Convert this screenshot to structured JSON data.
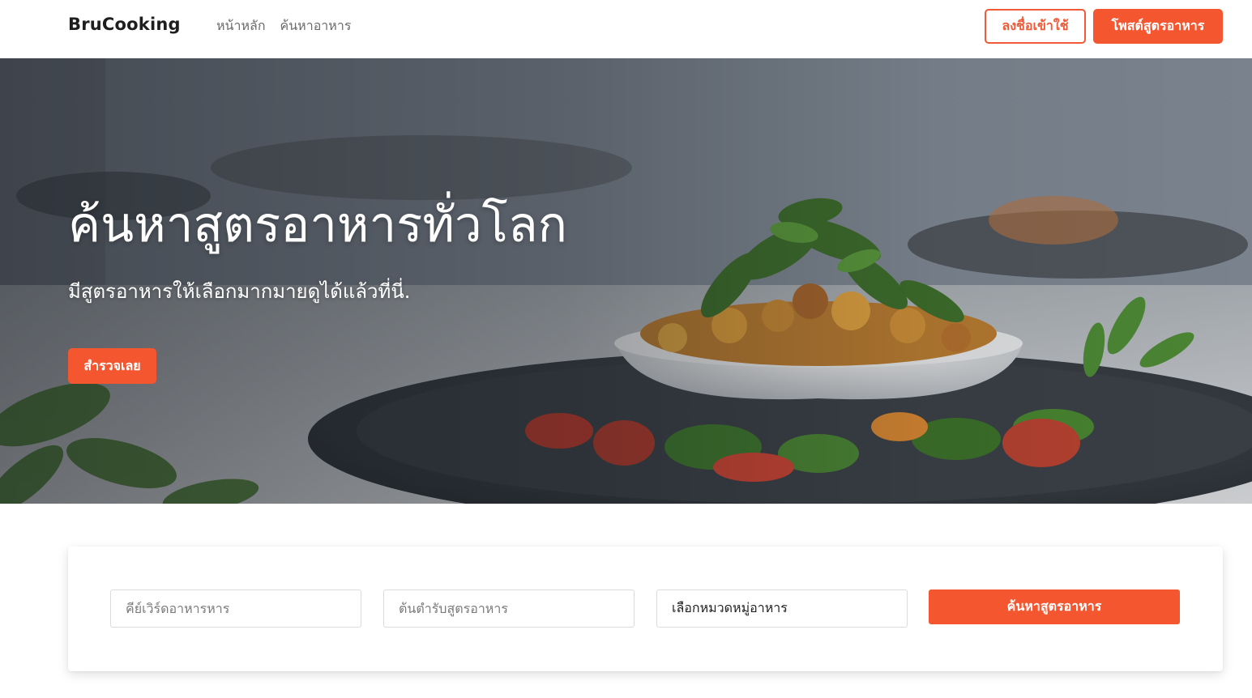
{
  "navbar": {
    "brand": "BruCooking",
    "links": [
      "หน้าหลัก",
      "ค้นหาอาหาร"
    ],
    "login_label": "ลงชื่อเข้าใช้",
    "post_recipe_label": "โพสต์สูตรอาหาร"
  },
  "hero": {
    "title": "ค้นหาสูตรอาหารทั่วโลก",
    "subtitle": "มีสูตรอาหารให้เลือกมากมายดูได้แล้วที่นี่.",
    "cta_label": "สำรวจเลย"
  },
  "search": {
    "keyword_placeholder": "คีย์เวิร์ดอาหารหาร",
    "origin_placeholder": "ต้นตำรับสูตรอาหาร",
    "category_selected": "เลือกหมวดหมู่อาหาร",
    "submit_label": "ค้นหาสูตรอาหาร"
  },
  "colors": {
    "accent": "#f4562f",
    "accent_outline": "#f05a38"
  }
}
